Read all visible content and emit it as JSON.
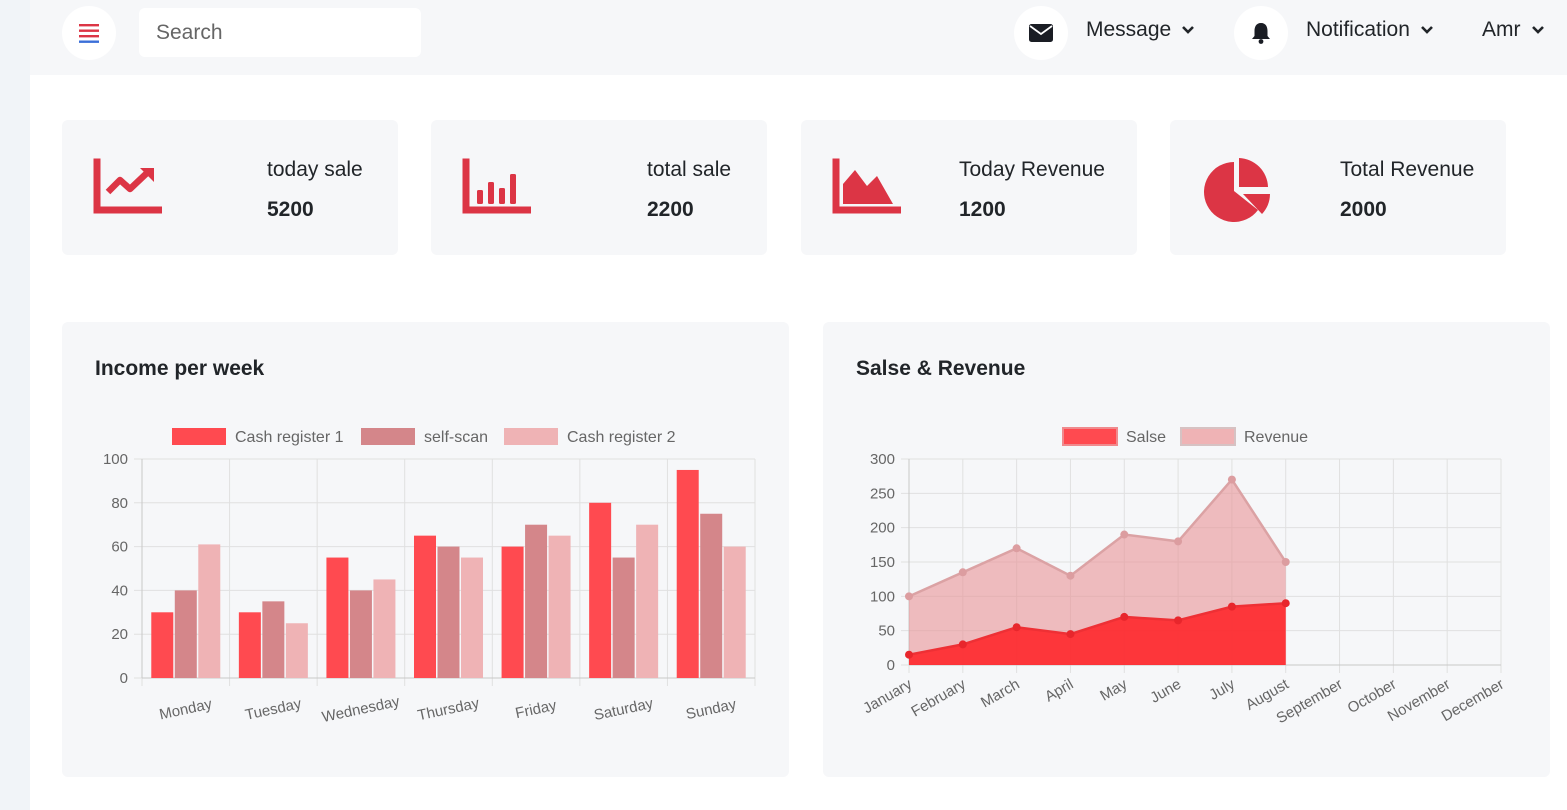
{
  "colors": {
    "accent": "#dc3545",
    "series1": "#ff4a50",
    "series2": "#d4868a",
    "series3": "#efb3b5",
    "axis_text": "#666666",
    "grid": "#e0e0e0"
  },
  "topbar": {
    "menu_icon": "hamburger-icon",
    "search_placeholder": "Search",
    "message_label": "Message",
    "message_icon": "envelope-icon",
    "notification_label": "Notification",
    "notification_icon": "bell-icon",
    "user_label": "Amr"
  },
  "stats": [
    {
      "label": "today sale",
      "value": "5200",
      "icon": "line-chart-icon"
    },
    {
      "label": "total sale",
      "value": "2200",
      "icon": "bar-chart-icon"
    },
    {
      "label": "Today Revenue",
      "value": "1200",
      "icon": "area-chart-icon"
    },
    {
      "label": "Total Revenue",
      "value": "2000",
      "icon": "pie-chart-icon"
    }
  ],
  "panels": {
    "income_title": "Income per week",
    "sales_title": "Salse & Revenue"
  },
  "chart_data": [
    {
      "type": "bar",
      "title": "Income per week",
      "categories": [
        "Monday",
        "Tuesday",
        "Wednesday",
        "Thursday",
        "Friday",
        "Saturday",
        "Sunday"
      ],
      "series": [
        {
          "name": "Cash register 1",
          "values": [
            30,
            30,
            55,
            65,
            60,
            80,
            95
          ]
        },
        {
          "name": "self-scan",
          "values": [
            40,
            35,
            40,
            60,
            70,
            55,
            75
          ]
        },
        {
          "name": "Cash register 2",
          "values": [
            61,
            25,
            45,
            55,
            65,
            70,
            60
          ]
        }
      ],
      "ylim": [
        0,
        100
      ],
      "yticks": [
        0,
        20,
        40,
        60,
        80,
        100
      ],
      "grid": true,
      "legend": "top"
    },
    {
      "type": "area",
      "title": "Salse & Revenue",
      "x": [
        "January",
        "February",
        "March",
        "April",
        "May",
        "June",
        "July",
        "August",
        "September",
        "October",
        "November",
        "December"
      ],
      "series": [
        {
          "name": "Salse",
          "values": [
            15,
            30,
            55,
            45,
            70,
            65,
            85,
            90
          ]
        },
        {
          "name": "Revenue",
          "values": [
            100,
            135,
            170,
            130,
            190,
            180,
            270,
            150
          ]
        }
      ],
      "ylim": [
        0,
        300
      ],
      "yticks": [
        0,
        50,
        100,
        150,
        200,
        250,
        300
      ],
      "grid": true,
      "legend": "top"
    }
  ]
}
